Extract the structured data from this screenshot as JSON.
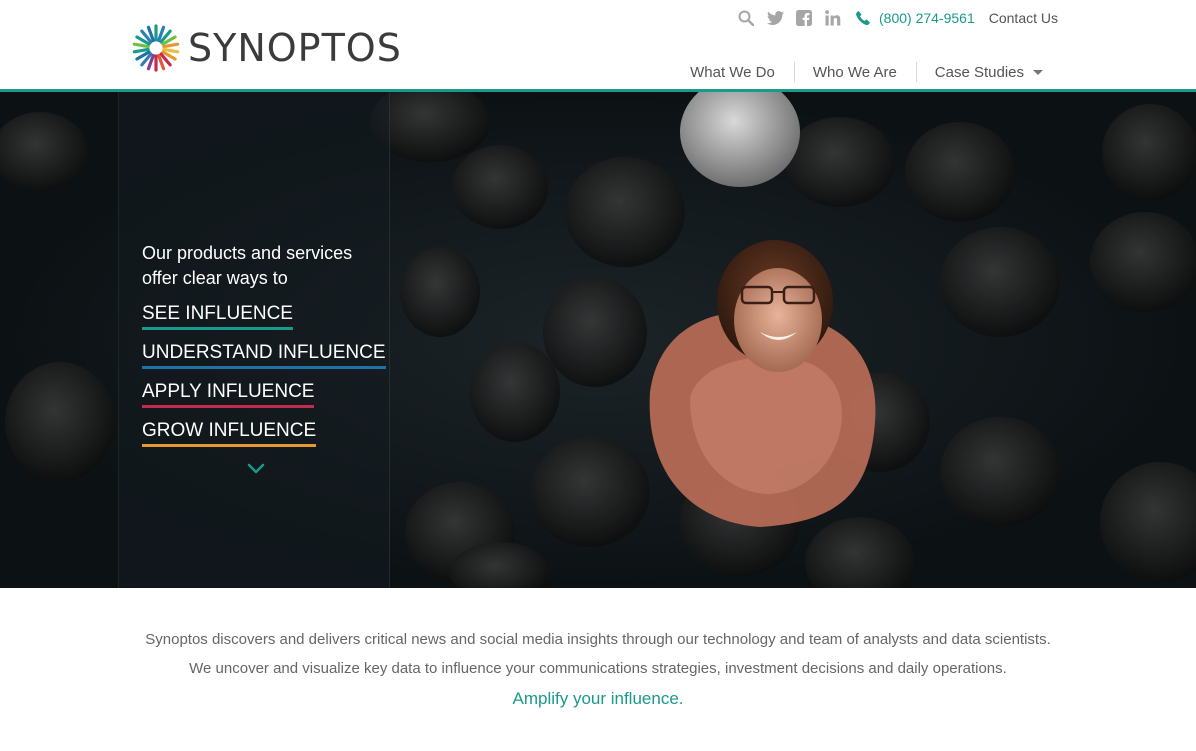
{
  "brand": {
    "name": "SYNOPTOS",
    "logo_icon": "sunburst-logo-icon",
    "accent": "#1a9a8a"
  },
  "utility": {
    "icons": [
      "search-icon",
      "twitter-icon",
      "facebook-icon",
      "linkedin-icon",
      "phone-icon"
    ],
    "phone": "(800) 274-9561",
    "contact": "Contact Us"
  },
  "nav": {
    "items": [
      {
        "label": "What We Do"
      },
      {
        "label": "Who We Are"
      },
      {
        "label": "Case Studies"
      }
    ]
  },
  "hero": {
    "intro_line1": "Our products and services",
    "intro_line2": "offer clear ways to",
    "links": [
      {
        "label": "SEE INFLUENCE",
        "color": "#1a9a8a"
      },
      {
        "label": "UNDERSTAND INFLUENCE",
        "color": "#1e73a6"
      },
      {
        "label": "APPLY INFLUENCE",
        "color": "#c42a4e"
      },
      {
        "label": "GROW INFLUENCE",
        "color": "#e59930"
      }
    ],
    "scroll_icon": "chevron-down-icon"
  },
  "intro": {
    "line1": "Synoptos discovers and delivers critical news and social media insights through our technology and team of analysts and data scientists.",
    "line2": "We uncover and visualize key data to influence your communications strategies, investment decisions and daily operations.",
    "tagline": "Amplify your influence."
  }
}
